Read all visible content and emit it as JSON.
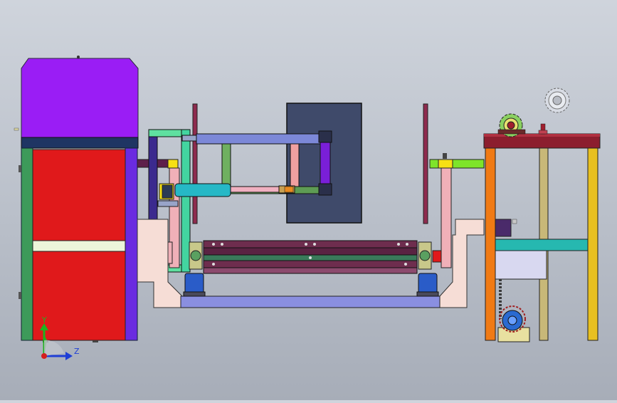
{
  "viewport": {
    "background_top": "#cfd4dc",
    "background_bottom": "#a7adb8"
  },
  "triad": {
    "y_label": "Y",
    "z_label": "Z",
    "y_color": "#1fb31f",
    "z_color": "#1f3fd6",
    "origin_color": "#d41e1e"
  },
  "colors": {
    "cabinet_top": "#9a1df5",
    "cabinet_body": "#e0191b",
    "cabinet_side": "#3d9a5a",
    "cabinet_band": "#ecf5d9",
    "frame_orange": "#f07a14",
    "frame_yellow": "#e8c020",
    "frame_tan": "#c8b878",
    "frame_top": "#8c1e2e",
    "panel_slate": "#3f4a6a",
    "roller_maroon": "#6e2d4e",
    "cylinder_teal": "#26b8c6",
    "bearing_blue": "#2a5cc8",
    "base_lavender": "#8a8fe0",
    "pipe_peach": "#f6ddd6"
  }
}
